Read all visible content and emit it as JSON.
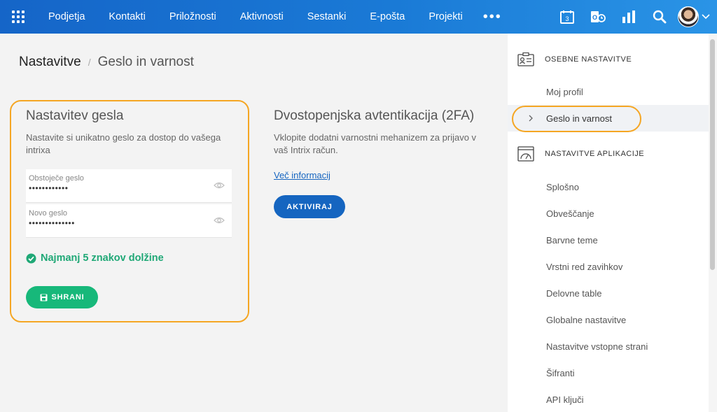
{
  "nav": {
    "items": [
      "Podjetja",
      "Kontakti",
      "Priložnosti",
      "Aktivnosti",
      "Sestanki",
      "E-pošta",
      "Projekti"
    ],
    "more": "•••",
    "calendar_day": "3"
  },
  "breadcrumb": {
    "root": "Nastavitve",
    "separator": "/",
    "current": "Geslo in varnost"
  },
  "password_card": {
    "title": "Nastavitev gesla",
    "description": "Nastavite si unikatno geslo za dostop do vašega intrixa",
    "current_label": "Obstoječe geslo",
    "current_value": "••••••••••••",
    "new_label": "Novo geslo",
    "new_value": "••••••••••••••",
    "rule": "Najmanj 5 znakov dolžine",
    "save_label": "SHRANI"
  },
  "two_factor": {
    "title": "Dvostopenjska avtentikacija (2FA)",
    "description": "Vklopite dodatni varnostni mehanizem za prijavo v vaš Intrix račun.",
    "link": "Več informacij",
    "button": "AKTIVIRAJ"
  },
  "sidebar": {
    "personal_header": "OSEBNE NASTAVITVE",
    "personal_items": [
      "Moj profil",
      "Geslo in varnost"
    ],
    "app_header": "NASTAVITVE APLIKACIJE",
    "app_items": [
      "Splošno",
      "Obveščanje",
      "Barvne teme",
      "Vrstni red zavihkov",
      "Delovne table",
      "Globalne nastavitve",
      "Nastavitve vstopne strani",
      "Šifranti",
      "API ključi"
    ]
  },
  "colors": {
    "brand": "#1565c8",
    "highlight": "#f5a623",
    "success": "#17b87a",
    "primary_button": "#1565c0"
  }
}
